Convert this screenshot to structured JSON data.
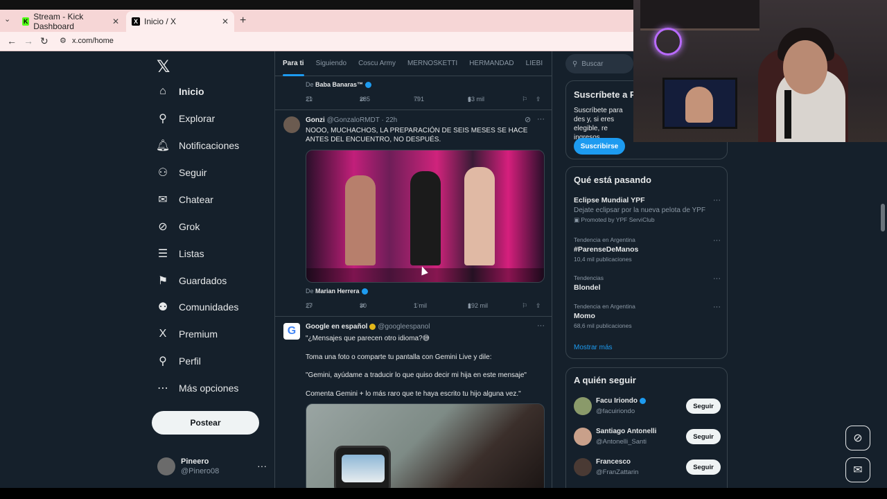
{
  "browser": {
    "tabs": [
      {
        "label": "Stream - Kick Dashboard",
        "favicon": "kick-icon"
      },
      {
        "label": "Inicio / X",
        "favicon": "x-icon"
      }
    ],
    "url": "x.com/home"
  },
  "sidebar": {
    "items": [
      {
        "label": "Inicio",
        "icon": "home-icon",
        "glyph": "⌂",
        "active": true
      },
      {
        "label": "Explorar",
        "icon": "search-icon",
        "glyph": "⚲"
      },
      {
        "label": "Notificaciones",
        "icon": "bell-icon",
        "glyph": "🔔︎"
      },
      {
        "label": "Seguir",
        "icon": "person-plus-icon",
        "glyph": "⚇"
      },
      {
        "label": "Chatear",
        "icon": "mail-icon",
        "glyph": "✉"
      },
      {
        "label": "Grok",
        "icon": "grok-icon",
        "glyph": "⊘"
      },
      {
        "label": "Listas",
        "icon": "list-icon",
        "glyph": "☰"
      },
      {
        "label": "Guardados",
        "icon": "bookmark-icon",
        "glyph": "⚑"
      },
      {
        "label": "Comunidades",
        "icon": "people-icon",
        "glyph": "⚉"
      },
      {
        "label": "Premium",
        "icon": "x-premium-icon",
        "glyph": "X"
      },
      {
        "label": "Perfil",
        "icon": "person-icon",
        "glyph": "⚲"
      },
      {
        "label": "Más opciones",
        "icon": "more-circle-icon",
        "glyph": "⋯"
      }
    ],
    "post_label": "Postear",
    "profile": {
      "name": "Pineero",
      "handle": "@Pinero08"
    }
  },
  "timeline": {
    "tabs": [
      "Para ti",
      "Siguiendo",
      "Coscu Army",
      "MERNOSKETTI",
      "HERMANDAD",
      "LIEBI"
    ],
    "top_credit": {
      "prefix": "De",
      "name": "Baba Banaras™"
    },
    "top_actions": {
      "replies": "21",
      "reposts": "285",
      "likes": "791",
      "views": "63 mil"
    },
    "tweet1": {
      "name": "Gonzi",
      "handle": "@GonzaloRMDT · 22h",
      "text": "NOOO, MUCHACHOS, LA PREPARACIÓN DE SEIS MESES SE HACE ANTES DEL ENCUENTRO, NO DESPUÉS.",
      "credit_prefix": "De",
      "credit_name": "Marian Herrera",
      "actions": {
        "replies": "27",
        "reposts": "30",
        "likes": "1 mil",
        "views": "192 mil"
      }
    },
    "tweet2": {
      "name": "Google en español",
      "handle": "@googleespanol",
      "lines": [
        "\"¿Mensajes que parecen otro idioma?😅",
        "Toma una foto o comparte tu pantalla con Gemini Live y dile:",
        "\"Gemini, ayúdame a traducir lo que quiso decir mi hija en este mensaje\"",
        "Comenta Gemini + lo más raro que te haya escrito tu hijo alguna vez.\""
      ]
    }
  },
  "right": {
    "search_placeholder": "Buscar",
    "subscribe": {
      "title": "Suscríbete a P",
      "body": "Suscríbete para des y, si eres elegible, re ingresos.",
      "button": "Suscribirse"
    },
    "trends": {
      "title": "Qué está pasando",
      "items": [
        {
          "context": "",
          "name": "Eclipse Mundial YPF",
          "count": "Dejate eclipsar por la nueva pelota de YPF",
          "promo": "Promoted by YPF ServiClub"
        },
        {
          "context": "Tendencia en Argentina",
          "name": "#ParenseDeManos",
          "count": "10,4 mil publicaciones"
        },
        {
          "context": "Tendencias",
          "name": "Blondel",
          "count": ""
        },
        {
          "context": "Tendencia en Argentina",
          "name": "Momo",
          "count": "68,6 mil publicaciones"
        }
      ],
      "show_more": "Mostrar más"
    },
    "who_to_follow": {
      "title": "A quién seguir",
      "items": [
        {
          "name": "Facu Iriondo",
          "handle": "@facuiriondo",
          "button": "Seguir"
        },
        {
          "name": "Santiago Antonelli",
          "handle": "@Antonelli_Santi",
          "button": "Seguir"
        },
        {
          "name": "Francesco",
          "handle": "@FranZattarin",
          "button": "Seguir"
        }
      ]
    }
  },
  "colors": {
    "bg": "#15202b",
    "accent": "#1d9bf0",
    "text": "#e7e9ea",
    "muted": "#8b98a5",
    "border": "#38444d"
  }
}
